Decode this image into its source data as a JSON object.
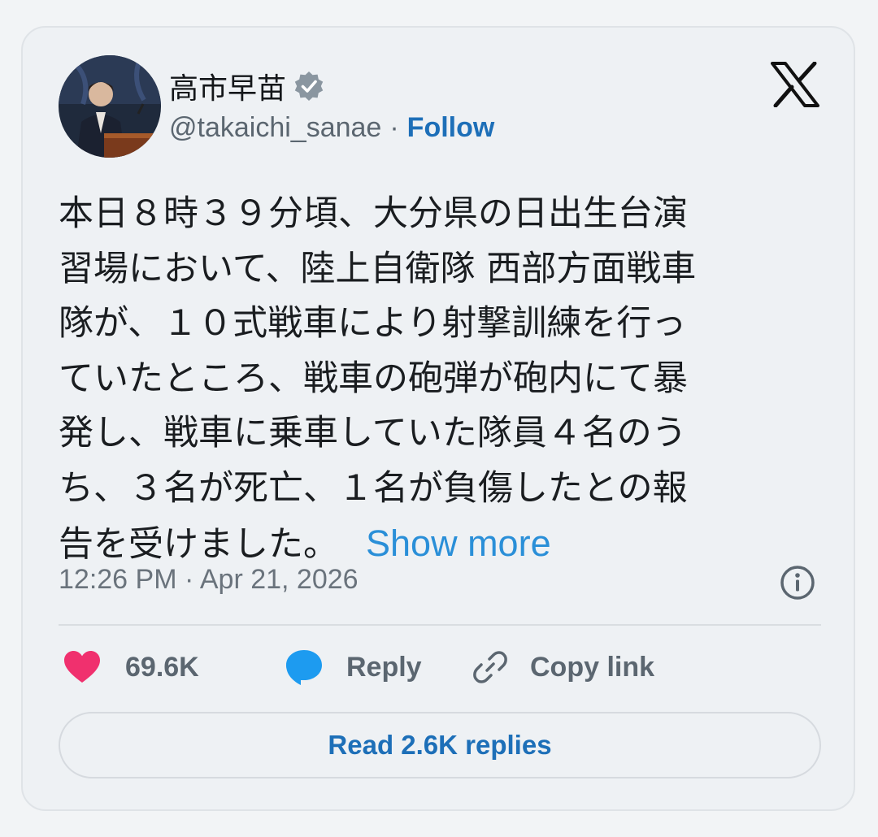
{
  "author": {
    "display_name": "高市早苗",
    "handle": "@takaichi_sanae",
    "separator": "·",
    "follow_label": "Follow"
  },
  "tweet": {
    "lines": [
      "本日８時３９分頃、大分県の日出生台演",
      "習場において、陸上自衛隊 西部方面戦車",
      "隊が、１０式戦車により射撃訓練を行っ",
      "ていたところ、戦車の砲弾が砲内にて暴",
      "発し、戦車に乗車していた隊員４名のう",
      "ち、３名が死亡、１名が負傷したとの報",
      "告を受けました。"
    ],
    "show_more_label": "Show more"
  },
  "timestamp": "12:26 PM · Apr 21, 2026",
  "actions": {
    "likes": "69.6K",
    "reply_label": "Reply",
    "copy_link_label": "Copy link"
  },
  "read_replies_label": "Read 2.6K replies",
  "colors": {
    "accent": "#1d6fb8",
    "show_more": "#2a8fd8",
    "heart": "#f0306e",
    "reply_bubble": "#1d9bf0",
    "verified": "#8a96a0"
  },
  "icons": {
    "verified": "verified-badge-icon",
    "brand": "x-logo-icon",
    "info": "info-icon",
    "like": "heart-icon",
    "reply": "speech-bubble-icon",
    "copy": "link-icon"
  }
}
